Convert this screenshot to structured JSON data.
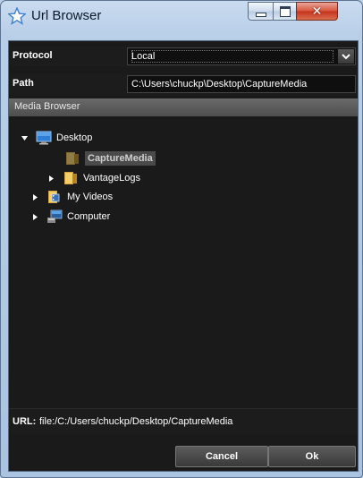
{
  "window": {
    "title": "Url Browser",
    "controls": {
      "minimize": "minimize-icon",
      "maximize": "maximize-icon",
      "close": "✕"
    }
  },
  "protocol": {
    "label": "Protocol",
    "selected": "Local"
  },
  "path": {
    "label": "Path",
    "value": "C:\\Users\\chuckp\\Desktop\\CaptureMedia"
  },
  "media_browser": {
    "header": "Media Browser",
    "tree": [
      {
        "label": "Desktop",
        "icon": "desktop-icon",
        "expander": "expanded"
      },
      {
        "label": "CaptureMedia",
        "icon": "folder-icon",
        "selected": true
      },
      {
        "label": "VantageLogs",
        "icon": "folder-icon",
        "expander": "collapsed"
      },
      {
        "label": "My Videos",
        "icon": "videos-library-icon",
        "expander": "collapsed"
      },
      {
        "label": "Computer",
        "icon": "computer-icon",
        "expander": "collapsed"
      }
    ]
  },
  "url": {
    "label": "URL:",
    "value": "file:/C:/Users/chuckp/Desktop/CaptureMedia"
  },
  "buttons": {
    "cancel": "Cancel",
    "ok": "Ok"
  },
  "colors": {
    "panel_bg": "#1a1a1a",
    "window_frame": "#b9cfe8",
    "selection": "#4a4a4a"
  }
}
